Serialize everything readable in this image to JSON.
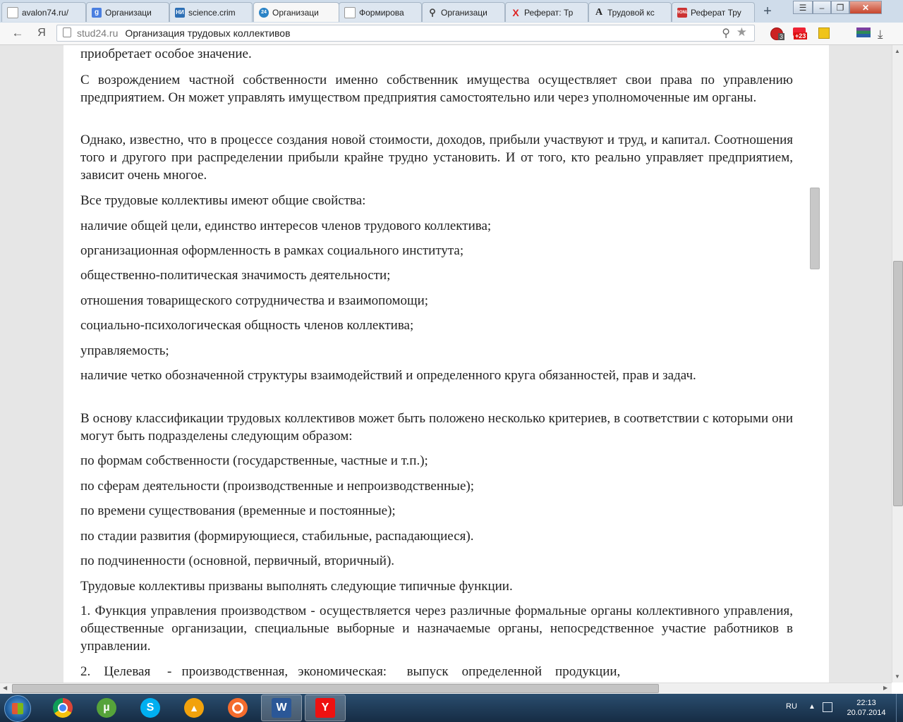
{
  "tabs": [
    {
      "label": "avalon74.ru/",
      "icon": "page-icon"
    },
    {
      "label": "Организаци",
      "icon": "google-icon"
    },
    {
      "label": "science.crim",
      "icon": "science-icon"
    },
    {
      "label": "Организаци",
      "icon": "stud24-icon",
      "active": true
    },
    {
      "label": "Формирова",
      "icon": "page-icon"
    },
    {
      "label": "Организаци",
      "icon": "search-icon"
    },
    {
      "label": "Реферат: Тр",
      "icon": "yandex-x-icon"
    },
    {
      "label": "Трудовой кс",
      "icon": "letter-a-icon"
    },
    {
      "label": "Реферат Тру",
      "icon": "ronl-icon"
    }
  ],
  "nav": {
    "back_symbol": "←",
    "yandex_symbol": "Я",
    "domain": "stud24.ru",
    "page_title": "Организация трудовых коллективов",
    "badge_adblock": "3",
    "badge_count": "+23"
  },
  "article": {
    "paragraphs": [
      "приобретает особое значение.",
      "С возрождением частной собственности именно собственник  имущества осуществляет свои права по управлению предприятием. Он может управлять имуществом предприятия самостоятельно или через уполномоченные им органы.",
      "Однако, известно, что в процессе создания новой стоимости, доходов, прибыли  участвуют и труд, и капитал. Соотношения того и другого при распределении прибыли крайне трудно установить. И от того, кто реально управляет предприятием, зависит очень многое.",
      "Все трудовые коллективы имеют общие свойства:",
      "наличие общей цели, единство интересов членов трудового коллектива;",
      "организационная оформленность в рамках социального  института;",
      "общественно-политическая значимость деятельности;",
      "отношения товарищеского сотрудничества и  взаимопомощи;",
      "социально-психологическая  общность членов коллектива;",
      "управляемость;",
      "наличие четко обозначенной структуры взаимодействий и определенного круга обязанностей, прав и задач.",
      "В основу классификации трудовых коллективов   может быть положено несколько критериев, в соответствии с которыми они  могут быть подразделены следующим  образом:",
      "по формам собственности (государственные, частные и т.п.);",
      "по сферам деятельности (производственные и непроизводственные);",
      "по времени  существования (временные и постоянные);",
      "по стадии развития (формирующиеся, стабильные, распадающиеся).",
      "по подчиненности (основной, первичный, вторичный).",
      "Трудовые  коллективы призваны выполнять следующие  типичные функции.",
      "1. Функция   управления производством - осуществляется   через различные формальные органы  коллективного управления, общественные  организации, специальные выборные и назначаемые органы, непосредственное участие работников в управлении.",
      "2.    Целевая     -   производственная,   экономическая:      выпуск    определенной    продукции,"
    ]
  },
  "taskbar": {
    "apps": [
      "chrome-icon",
      "utorrent-icon",
      "skype-icon",
      "aimp-icon",
      "origin-icon",
      "word-icon",
      "yandex-browser-icon"
    ],
    "word_label": "W",
    "language": "RU",
    "time": "22:13",
    "date": "20.07.2014"
  }
}
